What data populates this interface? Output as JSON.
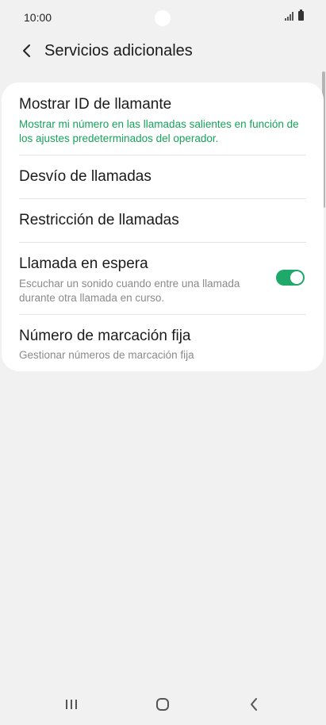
{
  "status_bar": {
    "time": "10:00"
  },
  "header": {
    "title": "Servicios adicionales"
  },
  "items": [
    {
      "title": "Mostrar ID de llamante",
      "subtitle": "Mostrar mi número en las llamadas salientes en función de los ajustes predeterminados del operador."
    },
    {
      "title": "Desvío de llamadas"
    },
    {
      "title": "Restricción de llamadas"
    },
    {
      "title": "Llamada en espera",
      "subtitle": "Escuchar un sonido cuando entre una llamada durante otra llamada en curso.",
      "toggle_on": true
    },
    {
      "title": "Número de marcación fija",
      "subtitle": "Gestionar números de marcación fija"
    }
  ],
  "colors": {
    "accent": "#1ea86a",
    "subtitle_green": "#16a35a",
    "background": "#f1f1f1"
  },
  "icons": [
    "back-icon",
    "signal-icon",
    "battery-icon",
    "recents-icon",
    "home-icon",
    "back-nav-icon"
  ]
}
